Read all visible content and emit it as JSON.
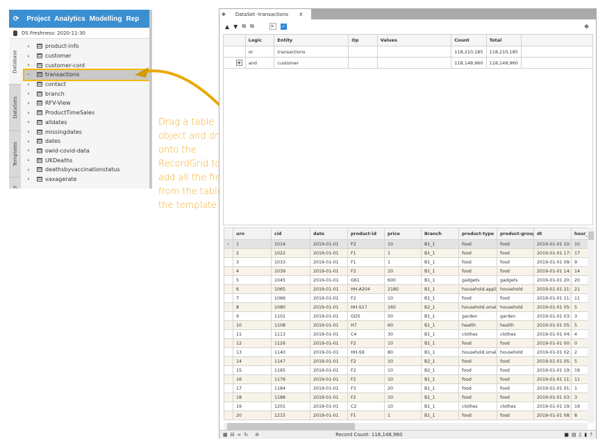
{
  "colors": {
    "nav": "#3a8fd0",
    "accent": "#f5b800",
    "annotation": "#f3aa1c",
    "arrow": "#e8a800"
  },
  "nav": {
    "items": [
      "Project",
      "Analytics",
      "Modelling",
      "Rep"
    ]
  },
  "freshness": "DS  Freshness: 2020-11-30",
  "side_tabs": [
    "Database",
    "DataSets",
    "Templates",
    "Reports"
  ],
  "tree": [
    "product-info",
    "customer",
    "customer-cont",
    "transactions",
    "contact",
    "branch",
    "RFV-View",
    "ProductTimeSales",
    "alldates",
    "missingdates",
    "dates",
    "owid-covid-data",
    "UKDeaths",
    "deathsbyvaccinationstatus",
    "vaxagerate"
  ],
  "tree_selected": "transactions",
  "window": {
    "tab_title": "DataSet -transactions",
    "close": "X"
  },
  "filter": {
    "headers": [
      "",
      "Logic",
      "Entity",
      "Op",
      "Values",
      "Count",
      "Total",
      ""
    ],
    "rows": [
      [
        "",
        "or",
        "transactions",
        "",
        "",
        "118,210,185",
        "118,210,185",
        ""
      ],
      [
        "+",
        "and",
        "customer",
        "",
        "",
        "118,148,960",
        "118,148,960",
        ""
      ]
    ]
  },
  "grid": {
    "headers": [
      "",
      "urn",
      "cid",
      "date",
      "product-id",
      "price",
      "Branch",
      "product-type",
      "product-group",
      "dt",
      "hour_"
    ],
    "rows": [
      [
        "1",
        "1014",
        "2019-01-01",
        "F2",
        "10",
        "B1_1",
        "food",
        "food",
        "2019-01-01 10:26",
        "10"
      ],
      [
        "2",
        "1022",
        "2019-01-01",
        "F1",
        "1",
        "B1_1",
        "food",
        "food",
        "2019-01-01 17:06",
        "17"
      ],
      [
        "3",
        "1033",
        "2019-01-01",
        "F1",
        "1",
        "B1_1",
        "food",
        "food",
        "2019-01-01 09:04",
        "9"
      ],
      [
        "4",
        "1039",
        "2019-01-01",
        "F2",
        "10",
        "B1_1",
        "food",
        "food",
        "2019-01-01 14:17",
        "14"
      ],
      [
        "5",
        "1045",
        "2019-01-01",
        "G61",
        "600",
        "B1_1",
        "gadgets",
        "gadgets",
        "2019-01-01 20:37",
        "20"
      ],
      [
        "6",
        "1065",
        "2019-01-01",
        "HH-A204",
        "2180",
        "B1_1",
        "household.applia",
        "household",
        "2019-01-01 21:56",
        "21"
      ],
      [
        "7",
        "1066",
        "2019-01-01",
        "F2",
        "10",
        "B1_1",
        "food",
        "food",
        "2019-01-01 11:19",
        "11"
      ],
      [
        "8",
        "1080",
        "2019-01-01",
        "HH-S17",
        "160",
        "B2_1",
        "household.small",
        "household",
        "2019-01-01 05:09",
        "5"
      ],
      [
        "9",
        "1101",
        "2019-01-01",
        "GD5",
        "50",
        "B1_1",
        "garden",
        "garden",
        "2019-01-01 03:17",
        "3"
      ],
      [
        "10",
        "1108",
        "2019-01-01",
        "H7",
        "60",
        "B1_1",
        "health",
        "health",
        "2019-01-01 05:10",
        "5"
      ],
      [
        "11",
        "1113",
        "2019-01-01",
        "C4",
        "30",
        "B1_1",
        "clothes",
        "clothes",
        "2019-01-01 04:08",
        "4"
      ],
      [
        "12",
        "1126",
        "2019-01-01",
        "F2",
        "10",
        "B1_1",
        "food",
        "food",
        "2019-01-01 00:37",
        "0"
      ],
      [
        "13",
        "1140",
        "2019-01-01",
        "HH-S9",
        "80",
        "B1_1",
        "household.small",
        "household",
        "2019-01-01 02:15",
        "2"
      ],
      [
        "14",
        "1147",
        "2019-01-01",
        "F2",
        "10",
        "B2_1",
        "food",
        "food",
        "2019-01-01 05:52",
        "5"
      ],
      [
        "15",
        "1165",
        "2019-01-01",
        "F2",
        "10",
        "B2_1",
        "food",
        "food",
        "2019-01-01 19:39",
        "19"
      ],
      [
        "16",
        "1176",
        "2019-01-01",
        "F2",
        "10",
        "B1_1",
        "food",
        "food",
        "2019-01-01 11:58",
        "11"
      ],
      [
        "17",
        "1184",
        "2019-01-01",
        "F3",
        "20",
        "B1_1",
        "food",
        "food",
        "2019-01-01 01:54",
        "1"
      ],
      [
        "18",
        "1188",
        "2019-01-01",
        "F2",
        "10",
        "B1_1",
        "food",
        "food",
        "2019-01-01 03:27",
        "3"
      ],
      [
        "19",
        "1201",
        "2019-01-01",
        "C2",
        "10",
        "B1_1",
        "clothes",
        "clothes",
        "2019-01-01 19:39",
        "19"
      ],
      [
        "20",
        "1215",
        "2019-01-01",
        "F1",
        "1",
        "B1_1",
        "food",
        "food",
        "2019-01-01 08:16",
        "8"
      ]
    ]
  },
  "status": {
    "record_count": "Record Count: 118,148,960"
  },
  "annotation": "Drag a table object and drop onto the RecordGrid to add all the fields from the table to the template"
}
